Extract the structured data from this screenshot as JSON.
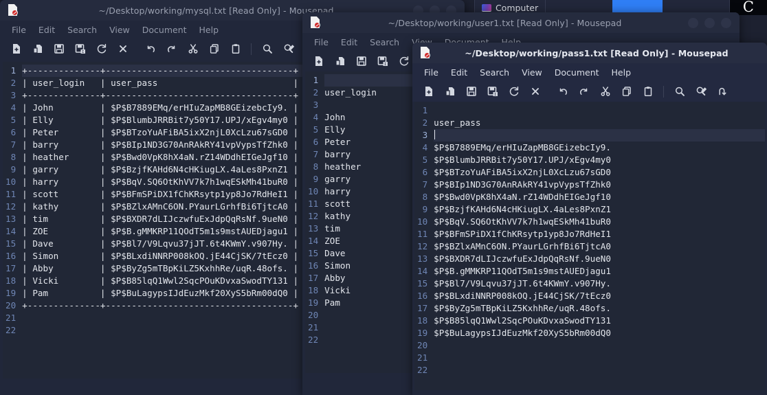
{
  "desktop": {
    "taskbar": {
      "computer_label": "Computer",
      "computer_icon": "monitor-icon",
      "logo_glyph": "C"
    },
    "background_color": "#1d2130"
  },
  "colors": {
    "window_bg": "#21273a",
    "titlebar_active": "#272d42",
    "titlebar_inactive": "#252b3e",
    "editor_bg": "#212736",
    "line_number": "#6f86b5",
    "text": "#e3e6ec",
    "current_line": "#2b3145",
    "accent_red": "#d12b2b",
    "taskbar_blue": "#2f7ef5"
  },
  "menu_items": [
    "File",
    "Edit",
    "Search",
    "View",
    "Document",
    "Help"
  ],
  "toolbar_icons": [
    "new-file-icon",
    "open-file-icon",
    "save-icon",
    "save-as-icon",
    "reload-icon",
    "close-icon",
    "undo-icon",
    "redo-icon",
    "cut-icon",
    "copy-icon",
    "paste-icon",
    "find-icon",
    "find-replace-icon",
    "goto-line-icon"
  ],
  "windows": [
    {
      "id": "mysql",
      "title": "~/Desktop/working/mysql.txt [Read Only] - Mousepad",
      "active": false,
      "window_controls": [
        "minimize",
        "maximize",
        "close"
      ],
      "current_line": 1,
      "lines": [
        "+--------------+------------------------------------+",
        "| user_login   | user_pass                          |",
        "+--------------+------------------------------------+",
        "| John         | $P$B7889EMq/erHIuZapMB8GEizebcIy9. |",
        "| Elly         | $P$BlumbJRRBit7y50Y17.UPJ/xEgv4my0 |",
        "| Peter        | $P$BTzoYuAFiBA5ixX2njL0XcLzu67sGD0 |",
        "| barry        | $P$BIp1ND3G70AnRAkRY41vpVypsTfZhk0 |",
        "| heather      | $P$Bwd0VpK8hX4aN.rZ14WDdhEIGeJgf10 |",
        "| garry        | $P$BzjfKAHd6N4cHKiugLX.4aLes8PxnZ1 |",
        "| harry        | $P$BqV.SQ6OtKhVV7k7h1wqESkMh41buR0 |",
        "| scott        | $P$BFmSPiDX1fChKRsytp1yp8Jo7RdHeI1 |",
        "| kathy        | $P$BZlxAMnC6ON.PYaurLGrhfBi6TjtcA0 |",
        "| tim          | $P$BXDR7dLIJczwfuExJdpQqRsNf.9ueN0 |",
        "| ZOE          | $P$B.gMMKRP11QOdT5m1s9mstAUEDjagu1 |",
        "| Dave         | $P$Bl7/V9Lqvu37jJT.6t4KWmY.v907Hy. |",
        "| Simon        | $P$BLxdiNNRP008kOQ.jE44CjSK/7tEcz0 |",
        "| Abby         | $P$ByZg5mTBpKiLZ5KxhhRe/uqR.48ofs. |",
        "| Vicki        | $P$B85lqQ1Wwl2SqcPOuKDvxaSwodTY131 |",
        "| Pam          | $P$BuLagypsIJdEuzMkf20XyS5bRm00dQ0 |",
        "+--------------+------------------------------------+",
        "",
        ""
      ]
    },
    {
      "id": "user1",
      "title": "~/Desktop/working/user1.txt [Read Only] - Mousepad",
      "active": false,
      "window_controls": [
        "minimize",
        "maximize",
        "close"
      ],
      "current_line": 1,
      "lines": [
        "",
        "user_login",
        "",
        "John",
        "Elly",
        "Peter",
        "barry",
        "heather",
        "garry",
        "harry",
        "scott",
        "kathy",
        "tim",
        "ZOE",
        "Dave",
        "Simon",
        "Abby",
        "Vicki",
        "Pam",
        "",
        "",
        ""
      ]
    },
    {
      "id": "pass1",
      "title": "~/Desktop/working/pass1.txt [Read Only] - Mousepad",
      "active": true,
      "window_controls": [],
      "current_line": 3,
      "lines": [
        "",
        "user_pass",
        "",
        "$P$B7889EMq/erHIuZapMB8GEizebcIy9.",
        "$P$BlumbJRRBit7y50Y17.UPJ/xEgv4my0",
        "$P$BTzoYuAFiBA5ixX2njL0XcLzu67sGD0",
        "$P$BIp1ND3G70AnRAkRY41vpVypsTfZhk0",
        "$P$Bwd0VpK8hX4aN.rZ14WDdhEIGeJgf10",
        "$P$BzjfKAHd6N4cHKiugLX.4aLes8PxnZ1",
        "$P$BqV.SQ6OtKhVV7k7h1wqESkMh41buR0",
        "$P$BFmSPiDX1fChKRsytp1yp8Jo7RdHeI1",
        "$P$BZlxAMnC6ON.PYaurLGrhfBi6TjtcA0",
        "$P$BXDR7dLIJczwfuExJdpQqRsNf.9ueN0",
        "$P$B.gMMKRP11QOdT5m1s9mstAUEDjagu1",
        "$P$Bl7/V9Lqvu37jJT.6t4KWmY.v907Hy.",
        "$P$BLxdiNNRP008kOQ.jE44CjSK/7tEcz0",
        "$P$ByZg5mTBpKiLZ5KxhhRe/uqR.48ofs.",
        "$P$B85lqQ1Wwl2SqcPOuKDvxaSwodTY131",
        "$P$BuLagypsIJdEuzMkf20XyS5bRm00dQ0",
        "",
        "",
        ""
      ]
    }
  ]
}
